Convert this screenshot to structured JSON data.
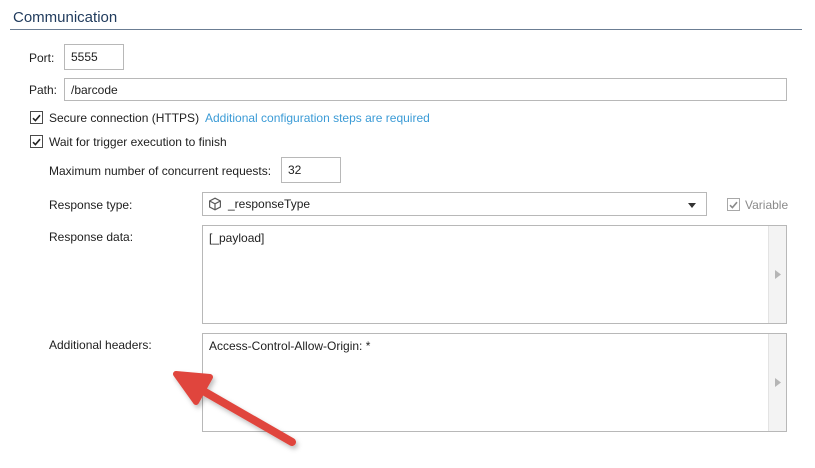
{
  "section": {
    "title": "Communication"
  },
  "port": {
    "label": "Port:",
    "value": "5555"
  },
  "path": {
    "label": "Path:",
    "value": "/barcode"
  },
  "secure": {
    "label": "Secure connection (HTTPS)",
    "checked": true,
    "link": "Additional configuration steps are required"
  },
  "wait": {
    "label": "Wait for trigger execution to finish",
    "checked": true
  },
  "max_requests": {
    "label": "Maximum number of concurrent requests:",
    "value": "32"
  },
  "response_type": {
    "label": "Response type:",
    "selected": "_responseType",
    "icon": "cube-icon",
    "variable_label": "Variable",
    "variable_checked": true
  },
  "response_data": {
    "label": "Response data:",
    "value": "[_payload]"
  },
  "additional_headers": {
    "label": "Additional headers:",
    "value": "Access-Control-Allow-Origin: *"
  },
  "colors": {
    "link": "#3b9bd6",
    "section_title": "#1f3a5c",
    "arrow": "#e0453c"
  }
}
